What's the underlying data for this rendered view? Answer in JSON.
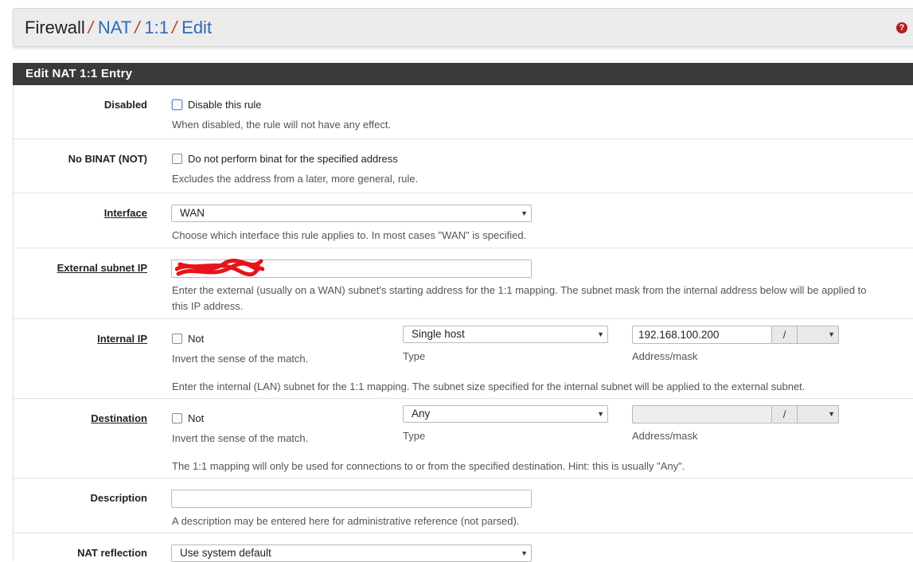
{
  "breadcrumb": {
    "items": [
      "Firewall",
      "NAT",
      "1:1",
      "Edit"
    ],
    "separator": "/"
  },
  "help_icon": "question-icon",
  "panel": {
    "title": "Edit NAT 1:1 Entry"
  },
  "fields": {
    "disabled": {
      "label": "Disabled",
      "checkbox_label": "Disable this rule",
      "help": "When disabled, the rule will not have any effect."
    },
    "nobinat": {
      "label": "No BINAT (NOT)",
      "checkbox_label": "Do not perform binat for the specified address",
      "help": "Excludes the address from a later, more general, rule."
    },
    "interface": {
      "label": "Interface",
      "value": "WAN",
      "help": "Choose which interface this rule applies to. In most cases \"WAN\" is specified."
    },
    "external": {
      "label": "External subnet IP",
      "value": "",
      "help_line1": "Enter the external (usually on a WAN) subnet's starting address for the 1:1 mapping. The subnet mask from the internal address below will be applied to",
      "help_line2": "this IP address."
    },
    "internal": {
      "label": "Internal IP",
      "not_label": "Not",
      "invert_help": "Invert the sense of the match.",
      "type_value": "Single host",
      "type_label": "Type",
      "address_value": "192.168.100.200",
      "slash": "/",
      "mask_value": "",
      "address_label": "Address/mask",
      "help": "Enter the internal (LAN) subnet for the 1:1 mapping. The subnet size specified for the internal subnet will be applied to the external subnet."
    },
    "destination": {
      "label": "Destination",
      "not_label": "Not",
      "invert_help": "Invert the sense of the match.",
      "type_value": "Any",
      "type_label": "Type",
      "address_value": "",
      "slash": "/",
      "mask_value": "",
      "address_label": "Address/mask",
      "help": "The 1:1 mapping will only be used for connections to or from the specified destination. Hint: this is usually \"Any\"."
    },
    "description": {
      "label": "Description",
      "value": "",
      "help": "A description may be entered here for administrative reference (not parsed)."
    },
    "nat_reflection": {
      "label": "NAT reflection",
      "value": "Use system default"
    }
  },
  "colors": {
    "header_bg": "#3a3a3a",
    "link": "#2a6db5",
    "separator": "#c0392b",
    "help_icon": "#b21e1e",
    "redaction": "#e8131b"
  }
}
